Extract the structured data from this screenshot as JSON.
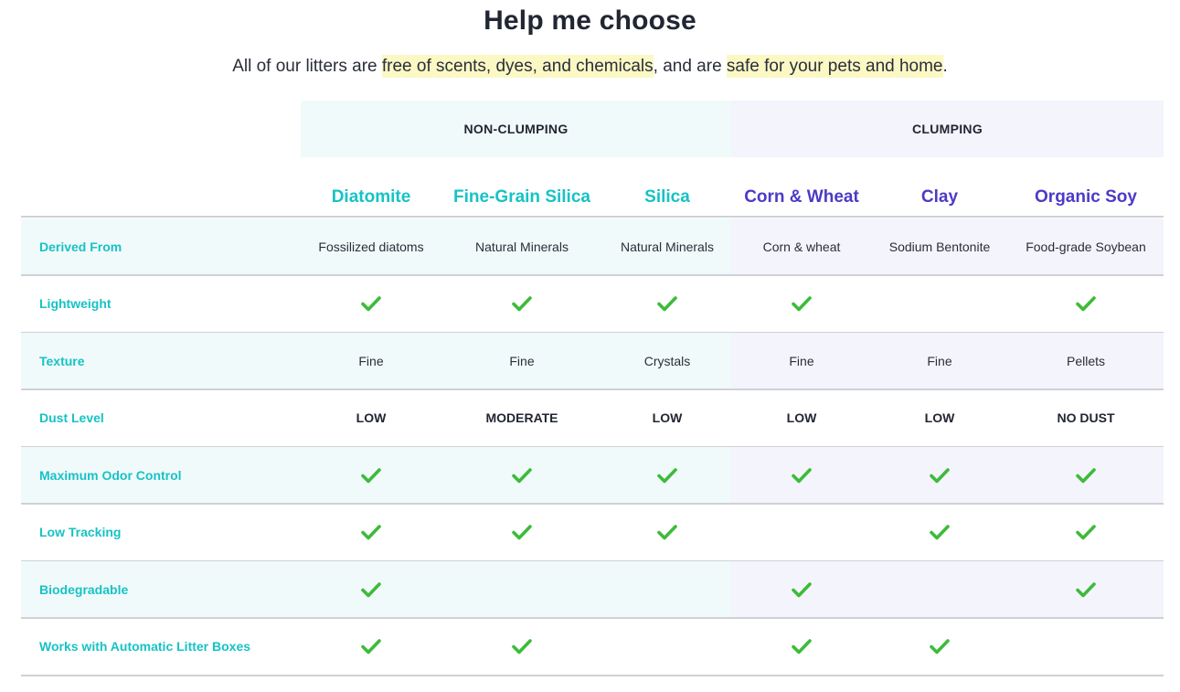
{
  "title": "Help me choose",
  "subtitle": {
    "prefix": "All of our litters are ",
    "highlight1": "free of scents, dyes, and chemicals",
    "middle": ", and are ",
    "highlight2": "safe for your pets and home",
    "suffix": "."
  },
  "groups": {
    "non_clumping": "NON-CLUMPING",
    "clumping": "CLUMPING"
  },
  "columns": [
    {
      "label": "Diatomite",
      "group": "non_clumping",
      "color": "#17c2c5"
    },
    {
      "label": "Fine-Grain Silica",
      "group": "non_clumping",
      "color": "#17c2c5"
    },
    {
      "label": "Silica",
      "group": "non_clumping",
      "color": "#17c2c5"
    },
    {
      "label": "Corn & Wheat",
      "group": "clumping",
      "color": "#4b3bc6"
    },
    {
      "label": "Clay",
      "group": "clumping",
      "color": "#4b3bc6"
    },
    {
      "label": "Organic Soy",
      "group": "clumping",
      "color": "#4b3bc6"
    }
  ],
  "rows": [
    {
      "label": "Derived From",
      "type": "text",
      "values": [
        "Fossilized diatoms",
        "Natural Minerals",
        "Natural Minerals",
        "Corn & wheat",
        "Sodium Bentonite",
        "Food-grade Soybean"
      ]
    },
    {
      "label": "Lightweight",
      "type": "check",
      "values": [
        true,
        true,
        true,
        true,
        false,
        true
      ]
    },
    {
      "label": "Texture",
      "type": "text",
      "values": [
        "Fine",
        "Fine",
        "Crystals",
        "Fine",
        "Fine",
        "Pellets"
      ]
    },
    {
      "label": "Dust Level",
      "type": "bold",
      "values": [
        "LOW",
        "MODERATE",
        "LOW",
        "LOW",
        "LOW",
        "NO DUST"
      ]
    },
    {
      "label": "Maximum Odor Control",
      "type": "check",
      "values": [
        true,
        true,
        true,
        true,
        true,
        true
      ]
    },
    {
      "label": "Low Tracking",
      "type": "check",
      "values": [
        true,
        true,
        true,
        false,
        true,
        true
      ]
    },
    {
      "label": "Biodegradable",
      "type": "check",
      "values": [
        true,
        false,
        false,
        true,
        false,
        true
      ]
    },
    {
      "label": "Works with Automatic Litter Boxes",
      "type": "check",
      "values": [
        true,
        true,
        false,
        true,
        true,
        false
      ]
    }
  ],
  "colors": {
    "teal_accent": "#17c2c5",
    "purple_accent": "#4b3bc6",
    "check_green": "#3dbb3a",
    "highlight": "#fbf8c4"
  },
  "icons": {
    "check": "checkmark-icon"
  }
}
